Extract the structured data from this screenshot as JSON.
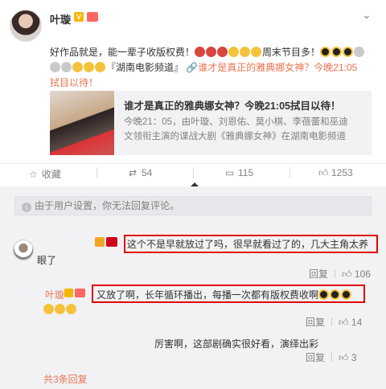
{
  "post": {
    "username": "叶璇",
    "verified_badge": "V",
    "text_line1": "好作品就是，能一辈子收版权费！",
    "text_line1_after": "周末节目多！",
    "text_line2_topic": "『湖南电影频道』",
    "text_line2_link": "🔗谁才是真正的雅典娜女神？今晚21:05",
    "text_line3": "拭目以待！",
    "card": {
      "title": "谁才是真正的雅典娜女神？今晚21:05拭目以待！",
      "desc_line1": "今晚21：05，由叶璇、刘恩佑、莫小棋、李蓓蕾和巫迪",
      "desc_line2": "文领衔主演的谍战大剧《雅典娜女神》在湖南电影频道"
    },
    "actions": {
      "favorite_label": "收藏",
      "repost_count": "54",
      "comment_count": "115",
      "like_count": "1253"
    }
  },
  "comments": {
    "notice": "由于用户设置，你无法回复评论。",
    "c1_line1": "这个不是早就放过了吗，很早就看过了的，几大主角太养",
    "c1_line2": "眼了",
    "c1_reply": "回复",
    "c1_likes": "106",
    "sub": {
      "name": "叶璇",
      "c2_line1": "又放了啊，长年循环播出，每播一次都有版权费收啊",
      "c2_reply": "回复",
      "c2_likes": "14",
      "c3_text": "厉害啊，这部剧确实很好看，演绎出彩",
      "c3_reply": "回复",
      "c3_likes": "3",
      "more_label": "共3条回复"
    }
  },
  "colors": {
    "accent": "#eb7350",
    "highlight_box": "#e10600",
    "comment_bg": "#f2f2f5"
  }
}
